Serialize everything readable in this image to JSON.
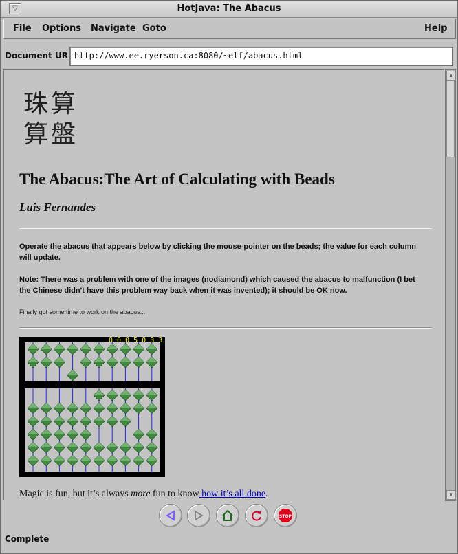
{
  "window": {
    "title": "HotJava: The Abacus"
  },
  "menu": [
    "File",
    "Options",
    "Navigate",
    "Goto",
    "Help"
  ],
  "url": {
    "label": "Document URL:",
    "value": "http://www.ee.ryerson.ca:8080/~elf/abacus.html"
  },
  "page": {
    "chinese_title": "珠算\n算盤",
    "heading": "The Abacus:The Art of Calculating with Beads",
    "author": "Luis Fernandes",
    "para1": "Operate the abacus that appears below by clicking the mouse-pointer on the beads; the value for each column will update.",
    "para2": "Note: There was a problem with one of the images (nodiamond) which caused the abacus to malfunction (I bet the Chinese didn't have this problem way back when it was invented); it should be OK now.",
    "para3": "Finally got some time to work on the abacus...",
    "abacus": {
      "display": "0 0 0 5 0 3 3 2",
      "upper_down": [
        0,
        0,
        0,
        1,
        0,
        0,
        0,
        0,
        0,
        0
      ],
      "lower_up": [
        0,
        0,
        0,
        0,
        0,
        3,
        3,
        3,
        2,
        2
      ]
    },
    "footer": {
      "text1": "Magic is fun, but it’s always ",
      "em": "more",
      "text2": " fun to know",
      "link": " how it’s all done",
      "end": "."
    }
  },
  "toolbar": {
    "icons": [
      "back-icon",
      "forward-icon",
      "home-icon",
      "reload-icon",
      "stop-icon"
    ],
    "stop_label": "STOP"
  },
  "status": "Complete"
}
